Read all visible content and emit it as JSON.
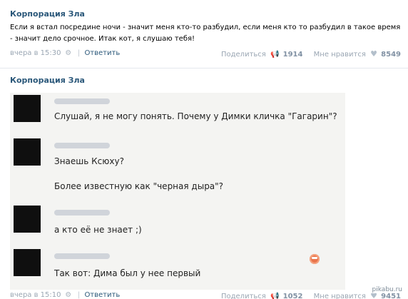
{
  "posts": [
    {
      "author": "Корпорация Зла",
      "text": "Если я встал посредине ночи - значит меня кто-то разбудил, если меня кто то разбудил в такое время - значит дело срочное. Итак кот, я слушаю тебя!",
      "time": "вчера в 15:30",
      "reply_label": "Ответить",
      "share_label": "Поделиться",
      "share_count": "1914",
      "like_label": "Мне нравится",
      "like_count": "8549"
    },
    {
      "author": "Корпорация Зла",
      "time": "вчера в 15:10",
      "reply_label": "Ответить",
      "share_label": "Поделиться",
      "share_count": "1052",
      "like_label": "Мне нравится",
      "like_count": "9451",
      "chat": {
        "messages": [
          {
            "text": "Слушай, я не могу понять. Почему у Димки кличка \"Гагарин\"?"
          },
          {
            "text": "Знаешь Ксюху?"
          },
          {
            "text": "Более известную как \"черная дыра\"?"
          },
          {
            "text": "а кто её не знает ;)"
          },
          {
            "text": "Так вот: Дима был у нее первый"
          }
        ]
      }
    }
  ],
  "watermark": "pikabu.ru",
  "icons": {
    "gear": "gear-icon",
    "share": "megaphone-icon",
    "like": "heart-icon",
    "emoji": "angry-face-icon"
  },
  "colors": {
    "link": "#2b587a",
    "muted": "#9aa6b3",
    "count": "#8292a4",
    "chat_bg": "#f4f4f2"
  }
}
